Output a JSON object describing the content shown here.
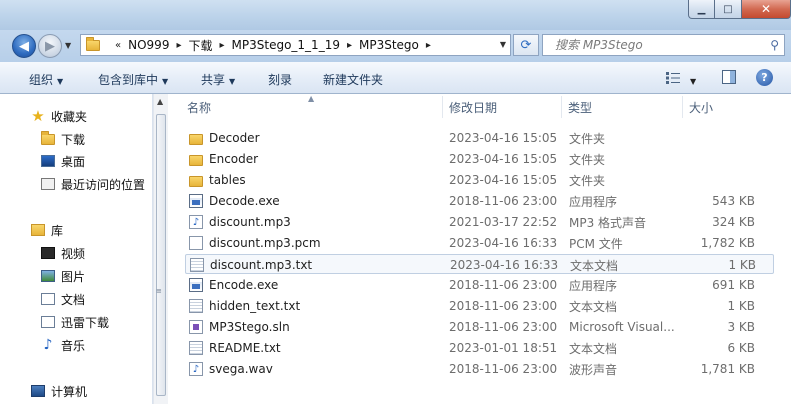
{
  "window": {
    "controls": {
      "minimize": "▁",
      "maximize": "□",
      "close": "✕"
    }
  },
  "address": {
    "prefix": "«",
    "breadcrumbs": [
      "NO999",
      "下载",
      "MP3Stego_1_1_19",
      "MP3Stego"
    ],
    "search_placeholder": "搜索 MP3Stego"
  },
  "toolbar": {
    "organize": "组织",
    "include_in_library": "包含到库中",
    "share": "共享",
    "burn": "刻录",
    "new_folder": "新建文件夹"
  },
  "nav": {
    "favorites_header": "收藏夹",
    "favorites": [
      "下载",
      "桌面",
      "最近访问的位置"
    ],
    "libraries_header": "库",
    "libraries": [
      "视频",
      "图片",
      "文档",
      "迅雷下载",
      "音乐"
    ],
    "computer": "计算机"
  },
  "columns": {
    "name": "名称",
    "modified": "修改日期",
    "type": "类型",
    "size": "大小"
  },
  "files": [
    {
      "name": "Decoder",
      "modified": "2023-04-16 15:05",
      "type": "文件夹",
      "size": "",
      "icon": "folder-icon"
    },
    {
      "name": "Encoder",
      "modified": "2023-04-16 15:05",
      "type": "文件夹",
      "size": "",
      "icon": "folder-icon"
    },
    {
      "name": "tables",
      "modified": "2023-04-16 15:05",
      "type": "文件夹",
      "size": "",
      "icon": "folder-icon"
    },
    {
      "name": "Decode.exe",
      "modified": "2018-11-06 23:00",
      "type": "应用程序",
      "size": "543 KB",
      "icon": "exe-icon"
    },
    {
      "name": "discount.mp3",
      "modified": "2021-03-17 22:52",
      "type": "MP3 格式声音",
      "size": "324 KB",
      "icon": "audio-file-icon"
    },
    {
      "name": "discount.mp3.pcm",
      "modified": "2023-04-16 16:33",
      "type": "PCM 文件",
      "size": "1,782 KB",
      "icon": "blank-file-icon"
    },
    {
      "name": "discount.mp3.txt",
      "modified": "2023-04-16 16:33",
      "type": "文本文档",
      "size": "1 KB",
      "icon": "text-file-icon",
      "selected": true
    },
    {
      "name": "Encode.exe",
      "modified": "2018-11-06 23:00",
      "type": "应用程序",
      "size": "691 KB",
      "icon": "exe-icon"
    },
    {
      "name": "hidden_text.txt",
      "modified": "2018-11-06 23:00",
      "type": "文本文档",
      "size": "1 KB",
      "icon": "text-file-icon"
    },
    {
      "name": "MP3Stego.sln",
      "modified": "2018-11-06 23:00",
      "type": "Microsoft Visual...",
      "size": "3 KB",
      "icon": "solution-file-icon"
    },
    {
      "name": "README.txt",
      "modified": "2023-01-01 18:51",
      "type": "文本文档",
      "size": "6 KB",
      "icon": "text-file-icon"
    },
    {
      "name": "svega.wav",
      "modified": "2018-11-06 23:00",
      "type": "波形声音",
      "size": "1,781 KB",
      "icon": "audio-file-icon"
    }
  ]
}
